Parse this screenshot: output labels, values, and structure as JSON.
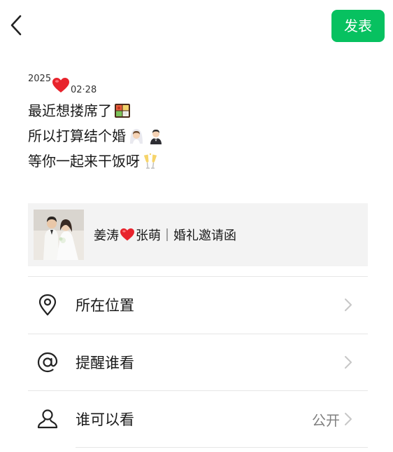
{
  "header": {
    "back_icon": "chevron-left-icon",
    "publish_label": "发表",
    "publish_color": "#07c160"
  },
  "post": {
    "date_year": "2025",
    "date_heart_icon": "red-heart-icon",
    "date_month_day": "02·28",
    "lines": [
      {
        "text": "最近想搂席了",
        "emoji": "bento-box-icon"
      },
      {
        "text": "所以打算结个婚",
        "emoji": "bride-groom-icon"
      },
      {
        "text": "等你一起来干饭呀",
        "emoji": "clinking-glasses-icon"
      }
    ]
  },
  "link_card": {
    "thumbnail": "wedding-photo-thumbnail",
    "title_part1": "姜涛",
    "title_heart_icon": "red-heart-icon",
    "title_part2": "张萌｜婚礼邀请函"
  },
  "options": [
    {
      "label": "所在位置",
      "icon": "location-pin-icon",
      "value": ""
    },
    {
      "label": "提醒谁看",
      "icon": "at-sign-icon",
      "value": ""
    },
    {
      "label": "谁可以看",
      "icon": "person-icon",
      "value": "公开"
    }
  ],
  "colors": {
    "accent": "#07c160",
    "heart": "#e8232c",
    "card_background": "#f3f3f3",
    "secondary_text": "#7f7f7f"
  }
}
